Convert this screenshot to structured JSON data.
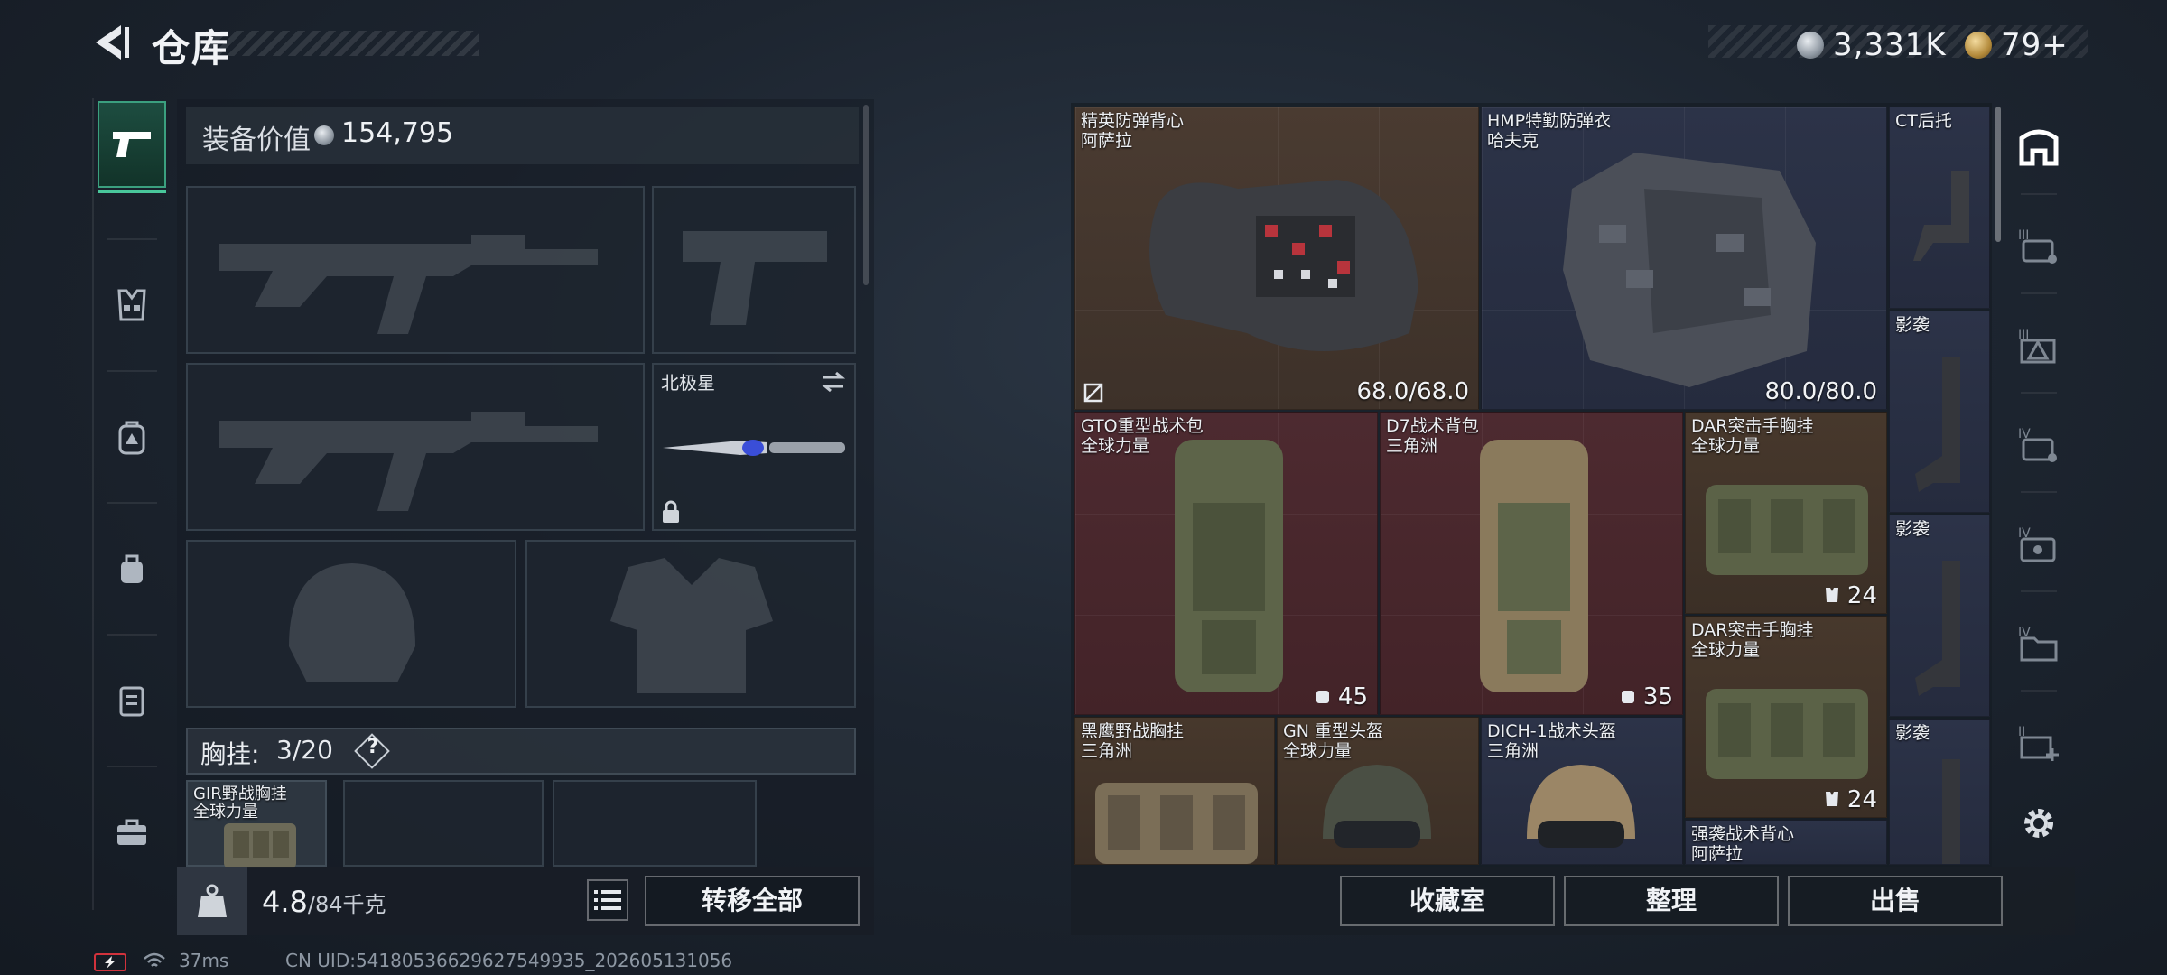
{
  "header": {
    "title": "仓库",
    "currency": [
      {
        "name": "coin",
        "amount": "3,331K"
      },
      {
        "name": "token",
        "amount": "79+"
      }
    ]
  },
  "sidebar": {
    "categories": [
      {
        "id": "weapons",
        "icon": "pistol-icon",
        "active": true
      },
      {
        "id": "chest-rig",
        "icon": "chest-rig-icon",
        "active": false
      },
      {
        "id": "backpack",
        "icon": "backpack-icon",
        "active": false
      },
      {
        "id": "pouch",
        "icon": "pouch-icon",
        "active": false
      },
      {
        "id": "armor-case",
        "icon": "case-icon",
        "active": false
      },
      {
        "id": "toolbox",
        "icon": "toolbox-icon",
        "active": false
      }
    ]
  },
  "loadout": {
    "value_label": "装备价值",
    "value": "154,795",
    "melee_name": "北极星",
    "vest_label": "胸挂:",
    "vest_used": "3",
    "vest_total": "/20",
    "vest_help": "?",
    "vest_item": {
      "name": "GIR野战胸挂",
      "brand": "全球力量"
    },
    "weight_current": "4.8",
    "weight_max": "/84千克",
    "transfer_all": "转移全部"
  },
  "stash": {
    "items": [
      {
        "name": "精英防弹背心",
        "brand": "阿萨拉",
        "stat": "68.0/68.0"
      },
      {
        "name": "HMP特勤防弹衣",
        "brand": "哈夫克",
        "stat": "80.0/80.0"
      },
      {
        "name": "CT后托",
        "brand": ""
      },
      {
        "name": "影袭",
        "brand": ""
      },
      {
        "name": "影袭",
        "brand": ""
      },
      {
        "name": "影袭",
        "brand": ""
      },
      {
        "name": "GTO重型战术包",
        "brand": "全球力量",
        "stat": "45"
      },
      {
        "name": "D7战术背包",
        "brand": "三角洲",
        "stat": "35"
      },
      {
        "name": "DAR突击手胸挂",
        "brand": "全球力量",
        "stat": "24"
      },
      {
        "name": "DAR突击手胸挂",
        "brand": "全球力量",
        "stat": "24"
      },
      {
        "name": "黑鹰野战胸挂",
        "brand": "三角洲"
      },
      {
        "name": "GN 重型头盔",
        "brand": "全球力量"
      },
      {
        "name": "DICH-1战术头盔",
        "brand": "三角洲"
      },
      {
        "name": "强袭战术背心",
        "brand": "阿萨拉"
      }
    ],
    "actions": {
      "collection": "收藏室",
      "organize": "整理",
      "sell": "出售"
    }
  },
  "status_bar": {
    "ping": "37ms",
    "uid": "CN UID:54180536629627549935_202605131056"
  }
}
